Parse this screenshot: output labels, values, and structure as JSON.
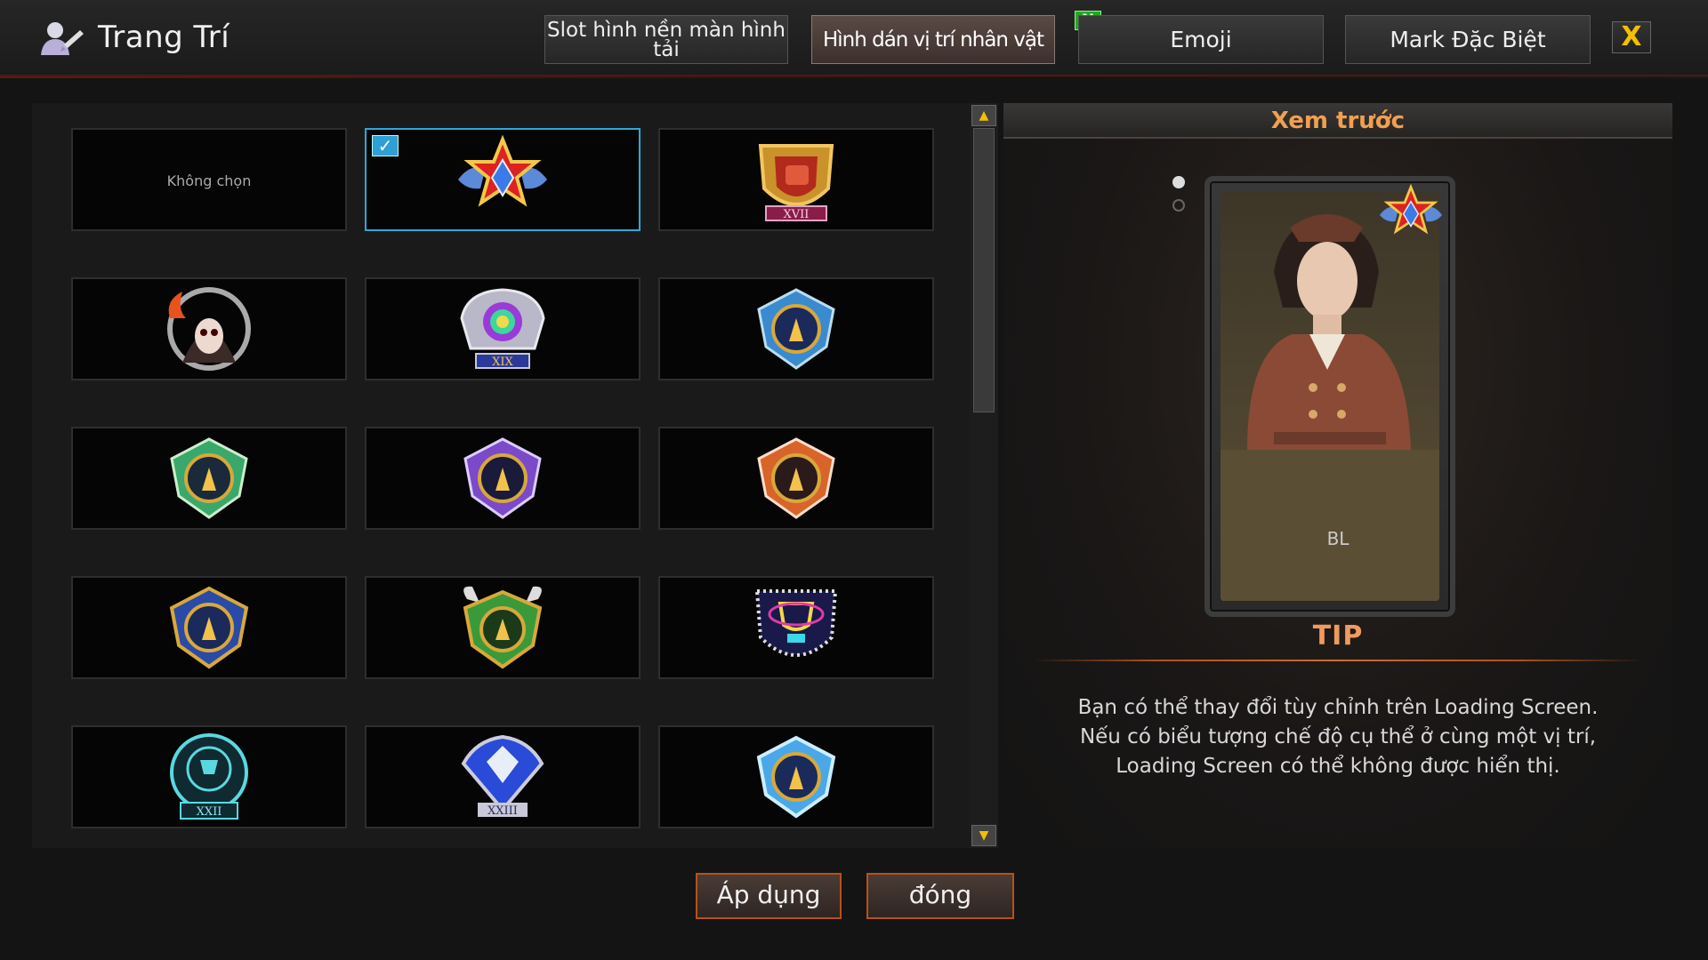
{
  "header": {
    "title": "Trang Trí",
    "tabs": [
      {
        "label": "Slot hình nền màn hình tải",
        "active": false
      },
      {
        "label": "Hình dán vị trí nhân vật",
        "active": true
      },
      {
        "label": "Emoji",
        "active": false,
        "badge": "N"
      },
      {
        "label": "Mark Đặc Biệt",
        "active": false
      }
    ],
    "close_symbol": "X"
  },
  "grid": {
    "none_label": "Không chọn",
    "selected_index": 1,
    "items": [
      {
        "icon": "none",
        "label": "Không chọn"
      },
      {
        "icon": "star-wings-emblem-icon",
        "label": ""
      },
      {
        "icon": "fist-shield-emblem-icon",
        "label": "XVII"
      },
      {
        "icon": "hooded-skull-emblem-icon",
        "label": ""
      },
      {
        "icon": "rainbow-trophy-emblem-icon",
        "label": "XIX"
      },
      {
        "icon": "blue-shield-emblem-icon",
        "label": ""
      },
      {
        "icon": "green-shield-emblem-icon",
        "label": ""
      },
      {
        "icon": "purple-shield-emblem-icon",
        "label": ""
      },
      {
        "icon": "orange-shield-emblem-icon",
        "label": ""
      },
      {
        "icon": "blue-gold-shield-emblem-icon",
        "label": ""
      },
      {
        "icon": "green-horned-shield-emblem-icon",
        "label": ""
      },
      {
        "icon": "neon-trophy-emblem-icon",
        "label": ""
      },
      {
        "icon": "cyan-trophy-emblem-icon",
        "label": "XXII"
      },
      {
        "icon": "blue-diamond-emblem-icon",
        "label": "XXIII"
      },
      {
        "icon": "light-blue-shield-emblem-icon",
        "label": ""
      }
    ]
  },
  "preview": {
    "title": "Xem trước",
    "character_name": "BL",
    "tip_title": "TIP",
    "tip_lines": [
      "Bạn có thể thay đổi tùy chỉnh trên Loading Screen.",
      "Nếu có biểu tượng chế độ cụ thể ở cùng một vị trí,",
      "Loading Screen có thể không được hiển thị."
    ]
  },
  "buttons": {
    "apply": "Áp dụng",
    "close": "đóng"
  },
  "colors": {
    "accent": "#f0a050",
    "selection": "#2fa8d8",
    "button_border": "#b8501e"
  }
}
